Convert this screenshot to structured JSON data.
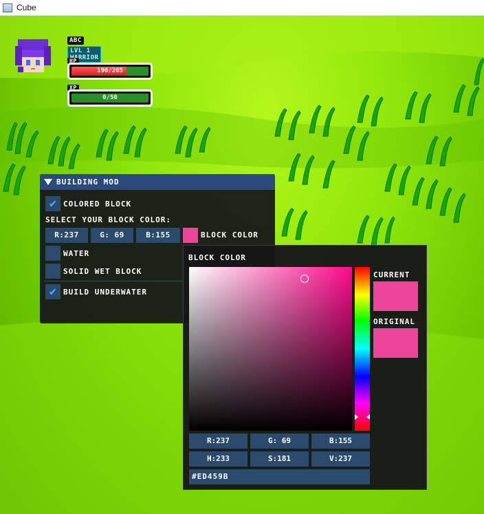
{
  "window": {
    "title": "Cube",
    "icon": "app-window-icon"
  },
  "hud": {
    "player_name": "ABC",
    "level_label": "LVL 1 WARRIOR",
    "hp_label": "HP",
    "hp_text": "190/265",
    "hp_fraction": 0.717,
    "xp_label": "XP",
    "xp_text": "0/50",
    "xp_fraction": 0.0
  },
  "building_mod": {
    "header": "BUILDING MOD",
    "colored_block": {
      "label": "COLORED BLOCK",
      "checked": true
    },
    "select_caption": "SELECT YOUR BLOCK COLOR:",
    "r_field": "R:237",
    "g_field": "G: 69",
    "b_field": "B:155",
    "swatch_color": "#ED459B",
    "block_color_label": "BLOCK COLOR",
    "water": {
      "label": "WATER",
      "checked": false
    },
    "solid_wet_block": {
      "label": "SOLID WET BLOCK",
      "checked": false
    },
    "build_underwater": {
      "label": "BUILD UNDERWATER",
      "checked": true
    }
  },
  "color_picker": {
    "title": "BLOCK COLOR",
    "current_label": "CURRENT",
    "original_label": "ORIGINAL",
    "current_color": "#ED459B",
    "original_color": "#ED459B",
    "r_field": "R:237",
    "g_field": "G: 69",
    "b_field": "B:155",
    "h_field": "H:233",
    "s_field": "S:181",
    "v_field": "V:237",
    "hex_field": "#ED459B"
  }
}
